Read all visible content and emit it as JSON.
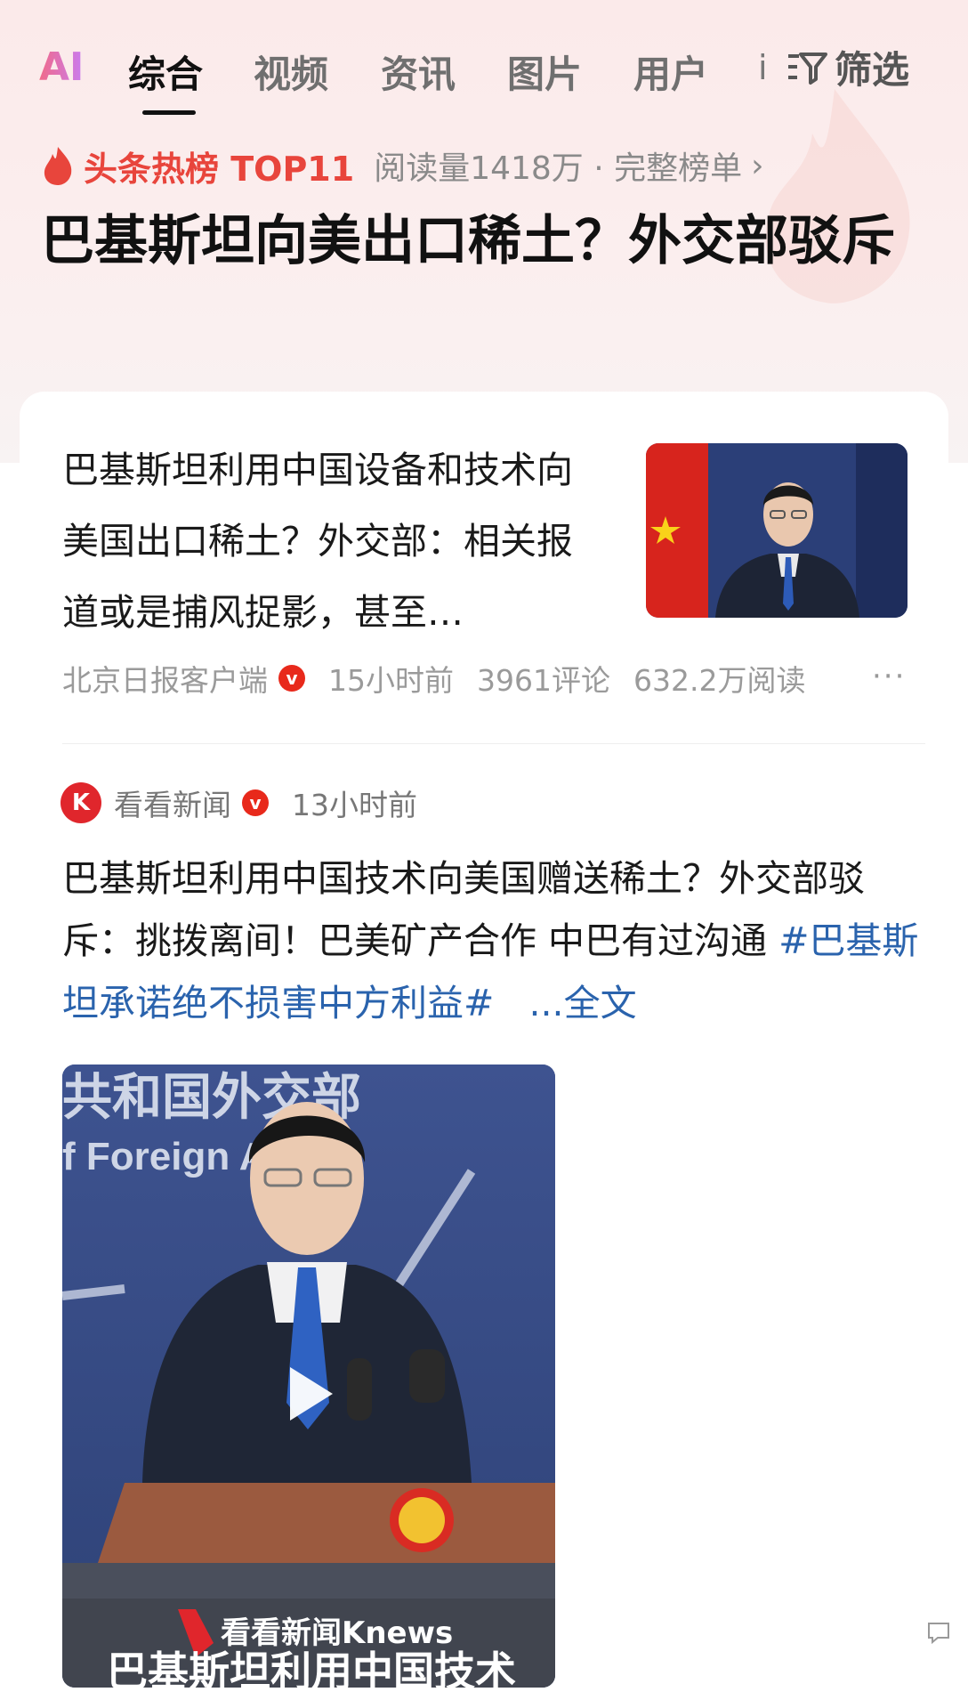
{
  "tabs": {
    "ai": "AI",
    "items": [
      "综合",
      "视频",
      "资讯",
      "图片",
      "用户"
    ],
    "more": "i",
    "filter": "筛选"
  },
  "hot": {
    "title": "头条热榜 TOP11",
    "meta": "阅读量1418万 · 完整榜单",
    "headline": "巴基斯坦向美出口稀土？外交部驳斥"
  },
  "article1": {
    "title": "巴基斯坦利用中国设备和技术向美国出口稀土？外交部：相关报道或是捕风捉影，甚至…",
    "source": "北京日报客户端",
    "time": "15小时前",
    "comments": "3961评论",
    "reads": "632.2万阅读",
    "more": "···"
  },
  "article2": {
    "source": "看看新闻",
    "time": "13小时前",
    "text": "巴基斯坦利用中国技术向美国赠送稀土？外交部驳斥：挑拨离间！巴美矿产合作 中巴有过沟通 ",
    "hashtag": "#巴基斯坦承诺绝不损害中方利益#",
    "fulltext": "...全文",
    "video_banner_top": "共和国外交部",
    "video_banner_en": "f Foreign Affairs",
    "video_logo": "看看新闻Knews",
    "video_caption": "巴基斯坦利用中国技术"
  },
  "colors": {
    "accent_red": "#e8453c",
    "link_blue": "#2a63ad",
    "verified_red": "#e8291b"
  }
}
